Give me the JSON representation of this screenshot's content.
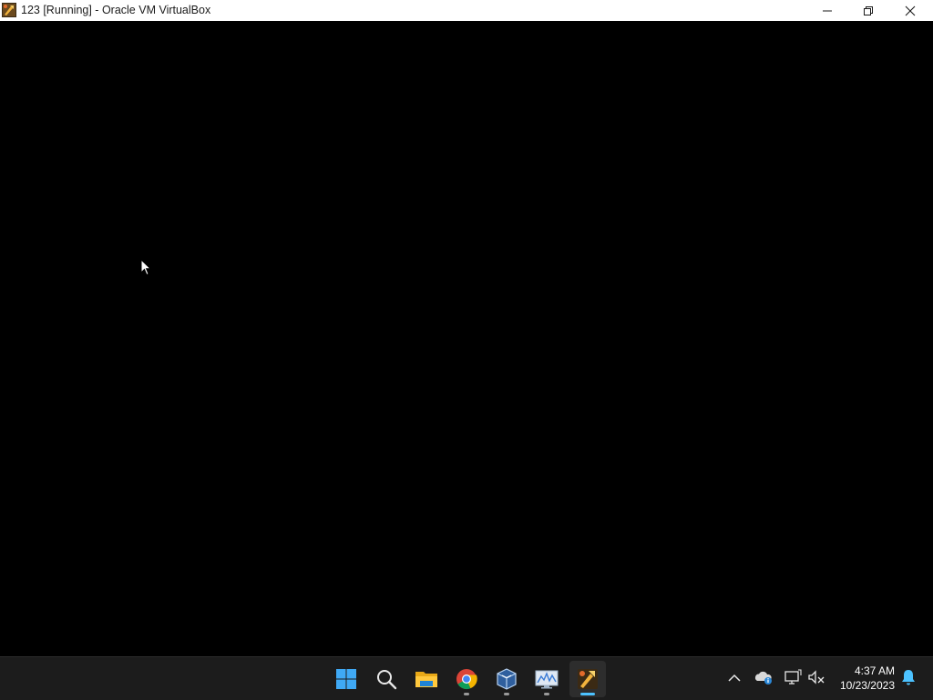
{
  "window": {
    "title": "123 [Running] - Oracle VM VirtualBox",
    "app_icon": "virtualbox-vm-icon",
    "controls": {
      "minimize": "minimize-icon",
      "maximize": "restore-icon",
      "close": "close-icon"
    }
  },
  "vm_screen": {
    "background": "#000000",
    "cursor": "arrow-cursor"
  },
  "taskbar": {
    "background": "#1c1c1c",
    "accent": "#4cc2ff",
    "pinned": [
      {
        "name": "start-button",
        "icon": "windows-logo-icon",
        "running": false
      },
      {
        "name": "search-button",
        "icon": "search-icon",
        "running": false
      },
      {
        "name": "file-explorer-button",
        "icon": "folder-icon",
        "running": false
      },
      {
        "name": "chrome-button",
        "icon": "chrome-icon",
        "running": true
      },
      {
        "name": "virtualbox-manager-button",
        "icon": "virtualbox-icon",
        "running": true
      },
      {
        "name": "performance-monitor-button",
        "icon": "monitor-chart-icon",
        "running": true
      },
      {
        "name": "vm-window-button",
        "icon": "virtualbox-vm-icon",
        "running": true,
        "active": true
      }
    ],
    "tray": {
      "icons": [
        "chevron-up-icon",
        "onedrive-icon",
        "network-icon",
        "volume-muted-icon",
        "bell-icon"
      ],
      "time": "4:37 AM",
      "date": "10/23/2023"
    }
  }
}
